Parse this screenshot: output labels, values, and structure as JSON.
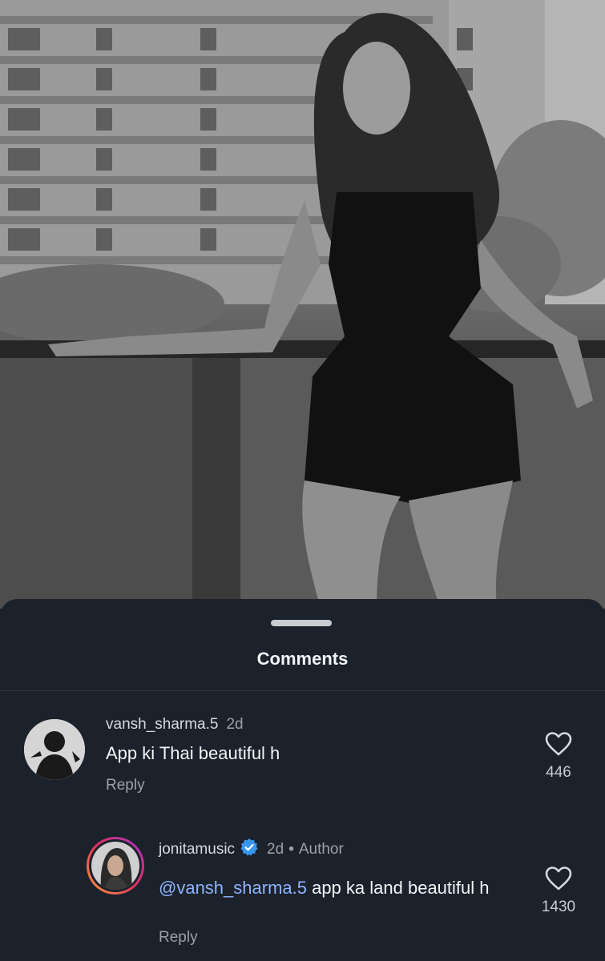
{
  "sheet": {
    "title": "Comments"
  },
  "comments": [
    {
      "username": "vansh_sharma.5",
      "time": "2d",
      "text": "App ki Thai beautiful h",
      "reply_label": "Reply",
      "like_count": "446",
      "avatar_icon": "user-avatar-icon"
    },
    {
      "username": "jonitamusic",
      "verified": true,
      "time": "2d",
      "author_badge": "Author",
      "mention": "@vansh_sharma.5",
      "text": " app ka land beautiful h",
      "reply_label": "Reply",
      "like_count": "1430",
      "avatar_icon": "user-avatar-icon"
    }
  ],
  "colors": {
    "sheet_bg": "#1c222b",
    "mention": "#8fb4ff",
    "verified": "#3897f0",
    "story_ring": [
      "#f9a13c",
      "#e3305d",
      "#a335c9"
    ]
  }
}
